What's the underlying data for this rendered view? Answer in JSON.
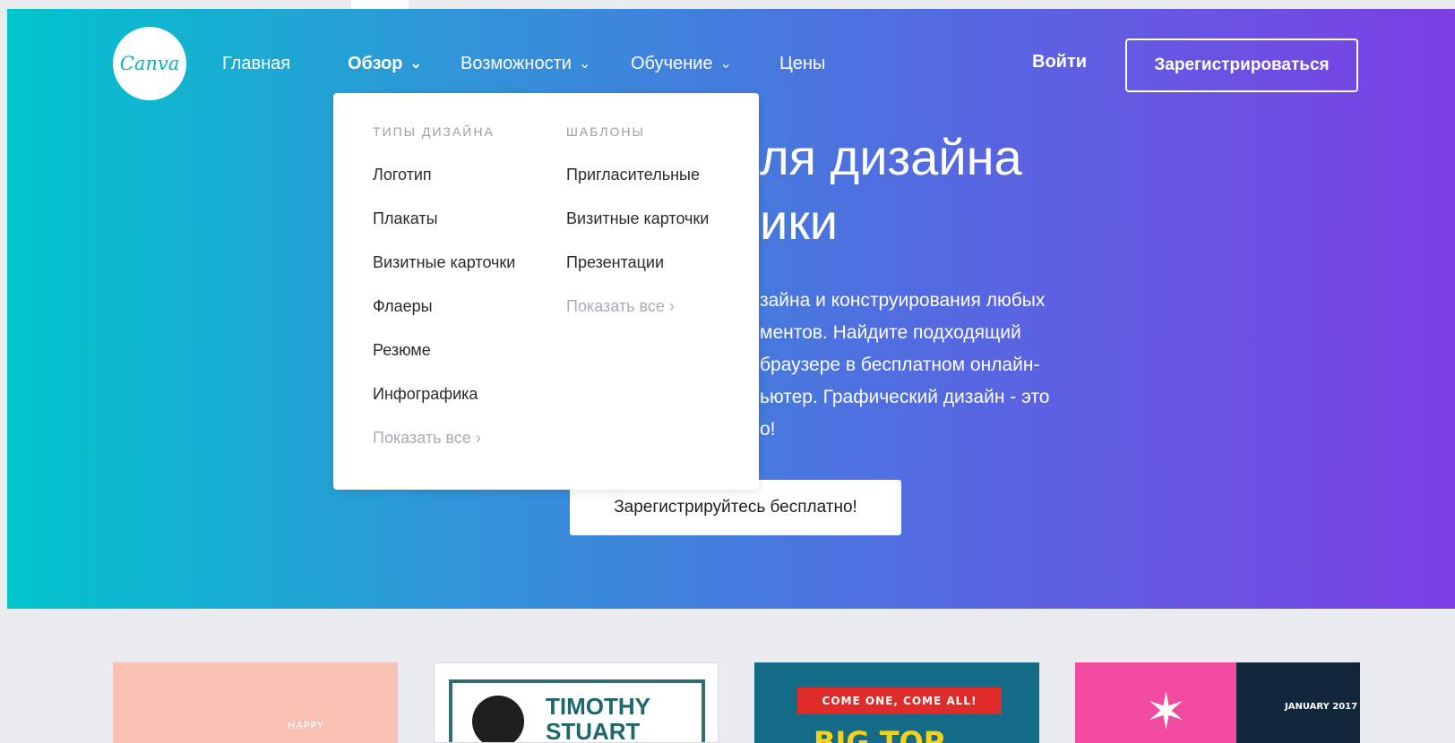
{
  "brand": {
    "logo_text": "Canva"
  },
  "nav": {
    "items": [
      {
        "label": "Главная",
        "has_chevron": false,
        "active": false
      },
      {
        "label": "Обзор",
        "has_chevron": true,
        "active": true
      },
      {
        "label": "Возможности",
        "has_chevron": true,
        "active": false
      },
      {
        "label": "Обучение",
        "has_chevron": true,
        "active": false
      },
      {
        "label": "Цены",
        "has_chevron": false,
        "active": false
      }
    ],
    "chevron_glyph": "⌄",
    "login_label": "Войти",
    "signup_label": "Зарегистрироваться"
  },
  "hero": {
    "title_line1": "ля дизайна",
    "title_line2": "ики",
    "text_lines": [
      "зайна и конструирования любых",
      "ментов. Найдите подходящий",
      "браузере в бесплатном онлайн-",
      "ьютер. Графический дизайн - это",
      "о!"
    ],
    "cta_label": "Зарегистрируйтесь бесплатно!"
  },
  "dropdown": {
    "col1": {
      "heading": "ТИПЫ ДИЗАЙНА",
      "items": [
        "Логотип",
        "Плакаты",
        "Визитные карточки",
        "Флаеры",
        "Резюме",
        "Инфографика"
      ],
      "show_all": "Показать все ›"
    },
    "col2": {
      "heading": "ШАБЛОНЫ",
      "items": [
        "Пригласительные",
        "Визитные карточки",
        "Презентации"
      ],
      "show_all": "Показать все ›"
    }
  },
  "cards": {
    "card1": {
      "text": "HAPPY"
    },
    "card2": {
      "title_line1": "TIMOTHY",
      "title_line2": "STUART"
    },
    "card3": {
      "ribbon": "COME ONE, COME ALL!",
      "big": "BIG TOP"
    },
    "card4": {
      "date": "JANUARY 2017",
      "spark": "✶"
    }
  },
  "colors": {
    "hero_gradient_start": "#00c4cc",
    "hero_gradient_end": "#7b3fe4",
    "logo_text": "#00b6c2",
    "page_bg": "#e9ebee"
  }
}
